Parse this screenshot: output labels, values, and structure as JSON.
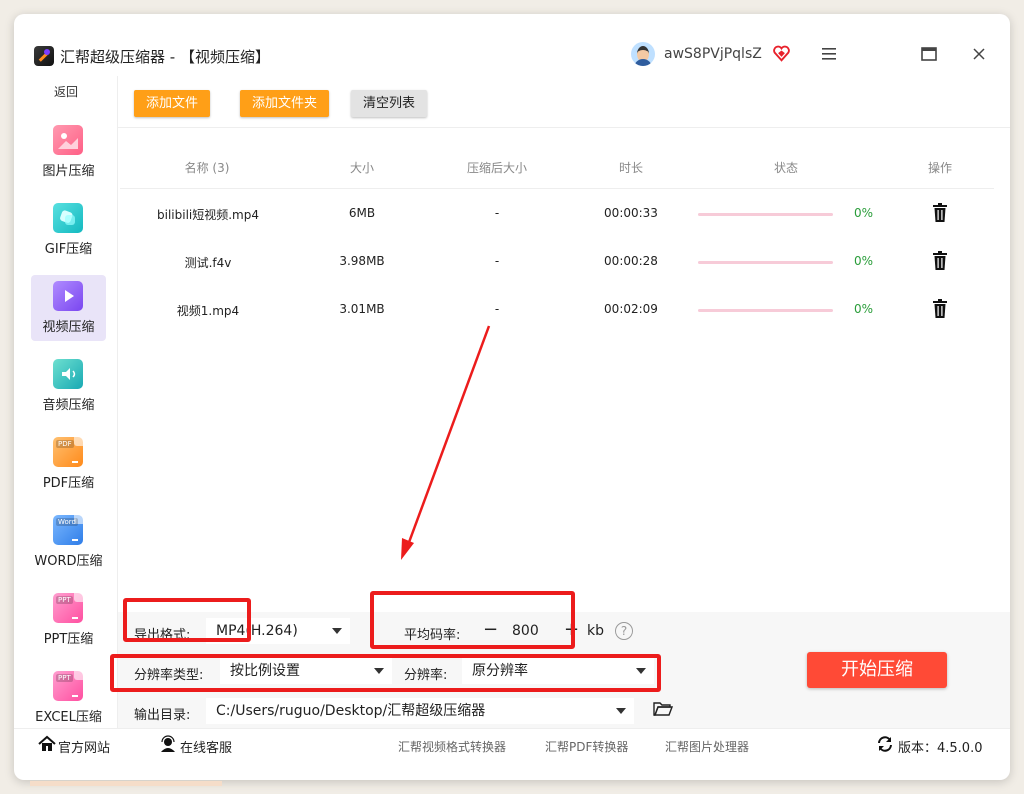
{
  "window": {
    "title": "汇帮超级压缩器 - 【视频压缩】",
    "username": "awS8PVjPqlsZ",
    "icons": {
      "logo": "app-logo-icon",
      "vip": "heart-diamond-icon",
      "menu": "hamburger-icon",
      "maximize": "maximize-icon",
      "close": "close-icon"
    }
  },
  "sidebar": {
    "back_label": "返回",
    "items": [
      {
        "label": "图片压缩",
        "icon": "image-icon",
        "color": "#ff6a8a"
      },
      {
        "label": "GIF压缩",
        "icon": "gif-icon",
        "color": "#1fc7c7"
      },
      {
        "label": "视频压缩",
        "icon": "video-play-icon",
        "color": "#8a5cf6"
      },
      {
        "label": "音频压缩",
        "icon": "audio-icon",
        "color": "#22b8b0"
      },
      {
        "label": "PDF压缩",
        "icon": "pdf-file-icon",
        "color": "#ff9a2e",
        "badge": "PDF"
      },
      {
        "label": "WORD压缩",
        "icon": "word-file-icon",
        "color": "#3d8ff2",
        "badge": "Word"
      },
      {
        "label": "PPT压缩",
        "icon": "ppt-file-icon",
        "color": "#ff5fa8",
        "badge": "PPT"
      },
      {
        "label": "EXCEL压缩",
        "icon": "excel-file-icon",
        "color": "#ff5fa8",
        "badge": "PPT"
      }
    ]
  },
  "toolbar": {
    "add_file": "添加文件",
    "add_folder": "添加文件夹",
    "clear_list": "清空列表"
  },
  "table": {
    "headers": [
      "名称 (3)",
      "大小",
      "压缩后大小",
      "时长",
      "状态",
      "操作"
    ],
    "rows": [
      {
        "name": "bilibili短视频.mp4",
        "size": "6MB",
        "compressed": "-",
        "duration": "00:00:33",
        "progress": 0,
        "status": "0%"
      },
      {
        "name": "测试.f4v",
        "size": "3.98MB",
        "compressed": "-",
        "duration": "00:00:28",
        "progress": 0,
        "status": "0%"
      },
      {
        "name": "视频1.mp4",
        "size": "3.01MB",
        "compressed": "-",
        "duration": "00:02:09",
        "progress": 0,
        "status": "0%"
      }
    ]
  },
  "settings": {
    "format_label": "导出格式:",
    "format_value": "MP4(H.264)",
    "bitrate_label": "平均码率:",
    "bitrate_value": "800",
    "bitrate_minus": "−",
    "bitrate_plus": "+",
    "bitrate_unit": "kb",
    "help": "?",
    "res_type_label": "分辨率类型:",
    "res_type_value": "按比例设置",
    "res_label": "分辨率:",
    "res_value": "原分辨率",
    "output_label": "输出目录:",
    "output_value": "C:/Users/ruguo/Desktop/汇帮超级压缩器",
    "start_button": "开始压缩"
  },
  "footer": {
    "official_site": "官方网站",
    "online_service": "在线客服",
    "links": [
      "汇帮视频格式转换器",
      "汇帮PDF转换器",
      "汇帮图片处理器"
    ],
    "version": "版本：4.5.0.0"
  },
  "colors": {
    "accent_orange": "#ff9f17",
    "start_red": "#ff4a36",
    "annotation_red": "#ec1c1c",
    "progress_track": "#f7cbd8",
    "status_green": "#2a9d3a"
  }
}
